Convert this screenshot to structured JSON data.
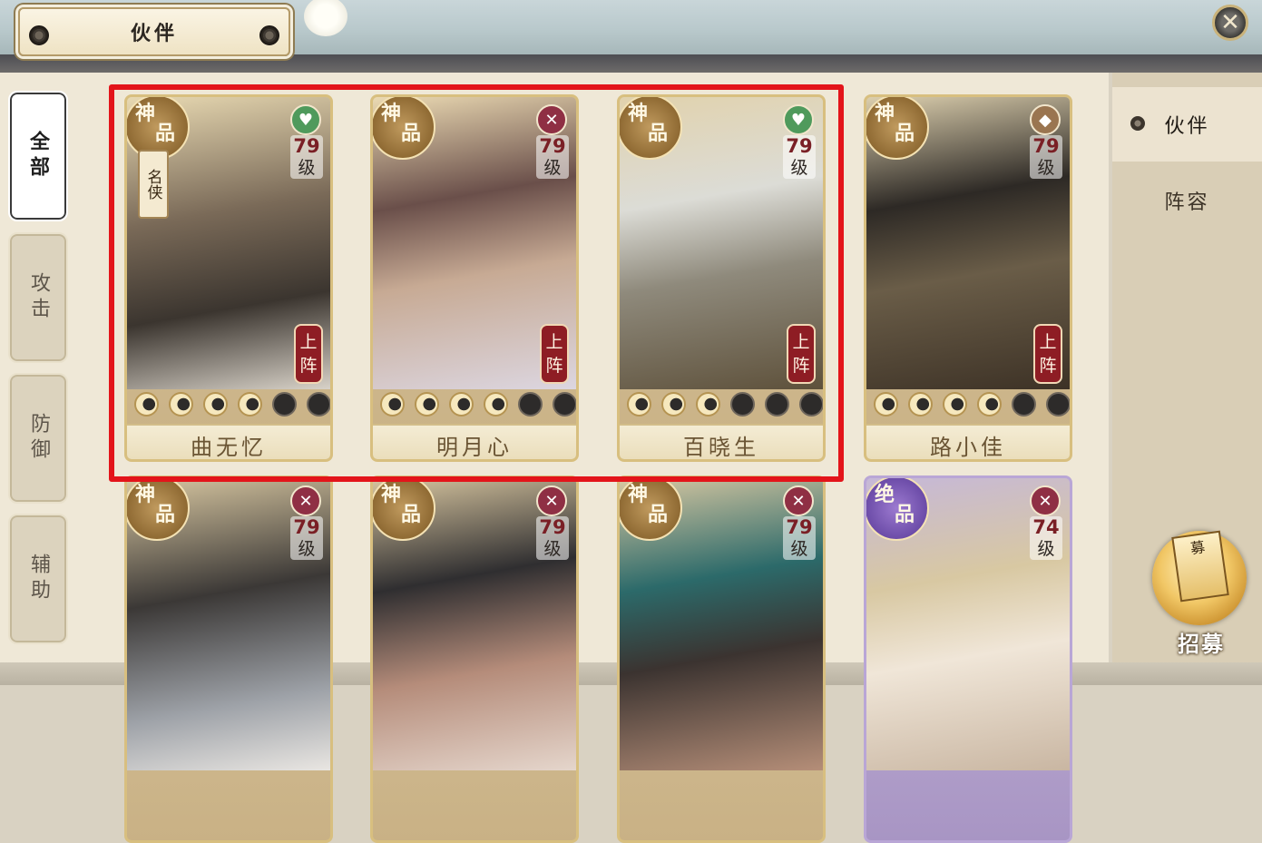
{
  "header": {
    "title": "伙伴",
    "close_icon": "✕"
  },
  "filters": [
    {
      "label": "全部",
      "active": true
    },
    {
      "label": "攻击",
      "active": false
    },
    {
      "label": "防御",
      "active": false
    },
    {
      "label": "辅助",
      "active": false
    }
  ],
  "side_tabs": [
    {
      "label": "伙伴",
      "active": true
    },
    {
      "label": "阵容",
      "active": false
    }
  ],
  "recruit": {
    "label": "招募",
    "card_glyph": "募"
  },
  "role_icons": {
    "heal": "♥",
    "attack": "✕",
    "defend": "◆"
  },
  "cards": [
    {
      "name": "曲无忆",
      "grade": [
        "神",
        "品"
      ],
      "title_tag": "名侠",
      "role": "heal",
      "level": "79",
      "level_unit": "级",
      "lineup": [
        "上",
        "阵"
      ],
      "stars": 4,
      "stars_max": 6
    },
    {
      "name": "明月心",
      "grade": [
        "神",
        "品"
      ],
      "role": "attack",
      "level": "79",
      "level_unit": "级",
      "lineup": [
        "上",
        "阵"
      ],
      "stars": 4,
      "stars_max": 6
    },
    {
      "name": "百晓生",
      "grade": [
        "神",
        "品"
      ],
      "role": "heal",
      "level": "79",
      "level_unit": "级",
      "lineup": [
        "上",
        "阵"
      ],
      "stars": 3,
      "stars_max": 6
    },
    {
      "name": "路小佳",
      "grade": [
        "神",
        "品"
      ],
      "role": "defend",
      "level": "79",
      "level_unit": "级",
      "lineup": [
        "上",
        "阵"
      ],
      "stars": 4,
      "stars_max": 6
    },
    {
      "name": "",
      "grade": [
        "神",
        "品"
      ],
      "role": "attack",
      "level": "79",
      "level_unit": "级"
    },
    {
      "name": "",
      "grade": [
        "神",
        "品"
      ],
      "role": "attack",
      "level": "79",
      "level_unit": "级"
    },
    {
      "name": "",
      "grade": [
        "神",
        "品"
      ],
      "role": "attack",
      "level": "79",
      "level_unit": "级"
    },
    {
      "name": "",
      "grade": [
        "绝",
        "品"
      ],
      "role": "attack",
      "level": "74",
      "level_unit": "级"
    }
  ],
  "colors": {
    "highlight": "#e3141a",
    "panel": "#efe8d7",
    "heal": "#4f9a5c",
    "attack": "#8f2f44",
    "defend": "#9a7550"
  }
}
